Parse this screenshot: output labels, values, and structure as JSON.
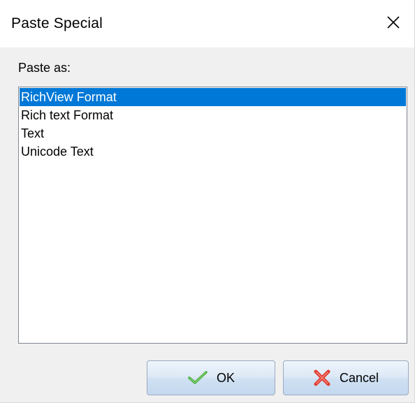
{
  "window": {
    "title": "Paste Special"
  },
  "dialog": {
    "paste_as_label": "Paste as:",
    "formats": [
      {
        "label": "RichView Format",
        "selected": true
      },
      {
        "label": "Rich text Format",
        "selected": false
      },
      {
        "label": "Text",
        "selected": false
      },
      {
        "label": "Unicode Text",
        "selected": false
      }
    ]
  },
  "buttons": {
    "ok_label": "OK",
    "cancel_label": "Cancel"
  },
  "icons": {
    "close": "close-icon",
    "ok": "check-icon",
    "cancel": "red-x-icon"
  },
  "colors": {
    "selection": "#0078d7",
    "check": "#3cab2c",
    "cancel_x": "#e03a2e"
  }
}
